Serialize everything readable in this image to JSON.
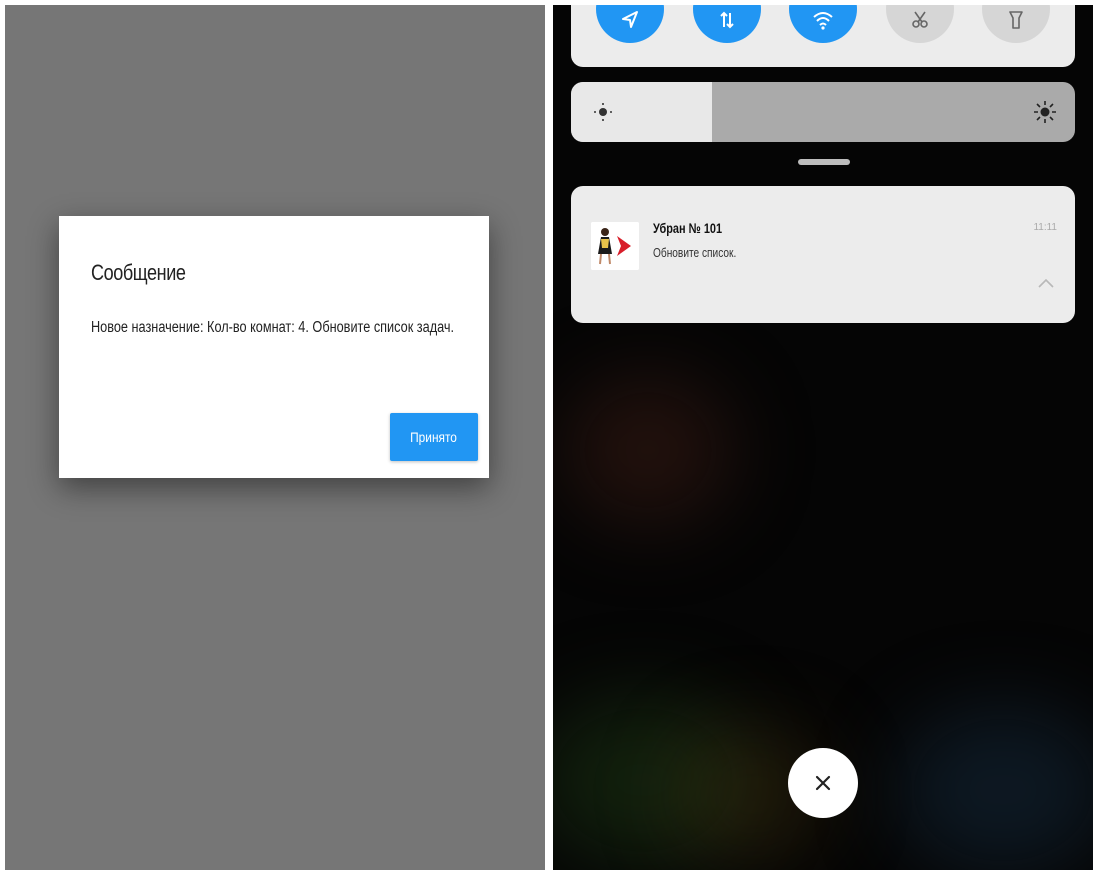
{
  "dialog": {
    "title": "Сообщение",
    "message": "Новое назначение: Кол-во комнат: 4. Обновите список задач.",
    "accept_label": "Принято",
    "accent_color": "#2196f3"
  },
  "quick_settings": {
    "tiles": [
      {
        "icon": "location-icon",
        "active": true
      },
      {
        "icon": "data-transfer-icon",
        "active": true
      },
      {
        "icon": "wifi-icon",
        "active": true
      },
      {
        "icon": "scissors-icon",
        "active": false
      },
      {
        "icon": "flashlight-icon",
        "active": false
      }
    ],
    "brightness_level": 0.28
  },
  "notification": {
    "title": "Убран № 101",
    "text": "Обновите список.",
    "time": "11:11",
    "app_icon": "cleaning-app-icon",
    "expand_icon": "chevron-up-icon"
  },
  "clear_button": {
    "icon": "close-icon"
  }
}
